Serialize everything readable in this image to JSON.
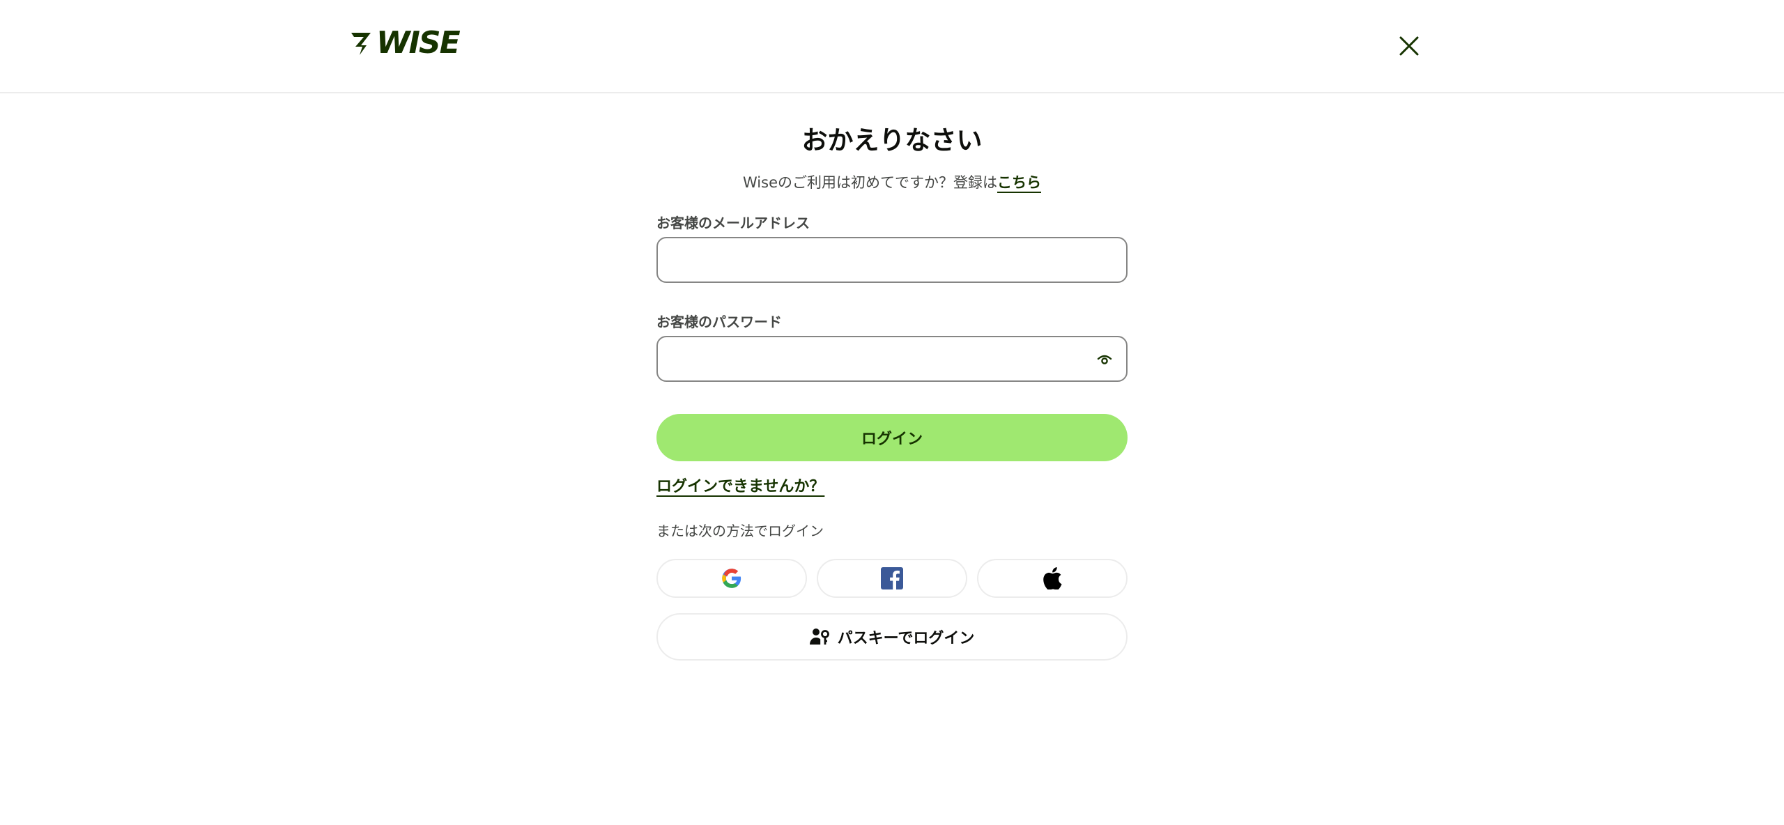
{
  "header": {
    "logo_text": "WISE",
    "close_label": "close"
  },
  "login": {
    "title": "おかえりなさい",
    "subtitle_text": "Wiseのご利用は初めてですか？登録は",
    "signup_link": "こちら",
    "email_label": "お客様のメールアドレス",
    "email_value": "",
    "password_label": "お客様のパスワード",
    "password_value": "",
    "login_button": "ログイン",
    "trouble_link": "ログインできませんか？",
    "alt_label": "または次の方法でログイン",
    "passkey_button": "パスキーでログイン"
  },
  "icons": {
    "google": "google-icon",
    "facebook": "facebook-icon",
    "apple": "apple-icon",
    "passkey": "passkey-icon",
    "eye": "eye-icon",
    "close": "close-icon"
  },
  "colors": {
    "brand": "#163300",
    "accent": "#9fe870",
    "facebook": "#3b5998"
  }
}
